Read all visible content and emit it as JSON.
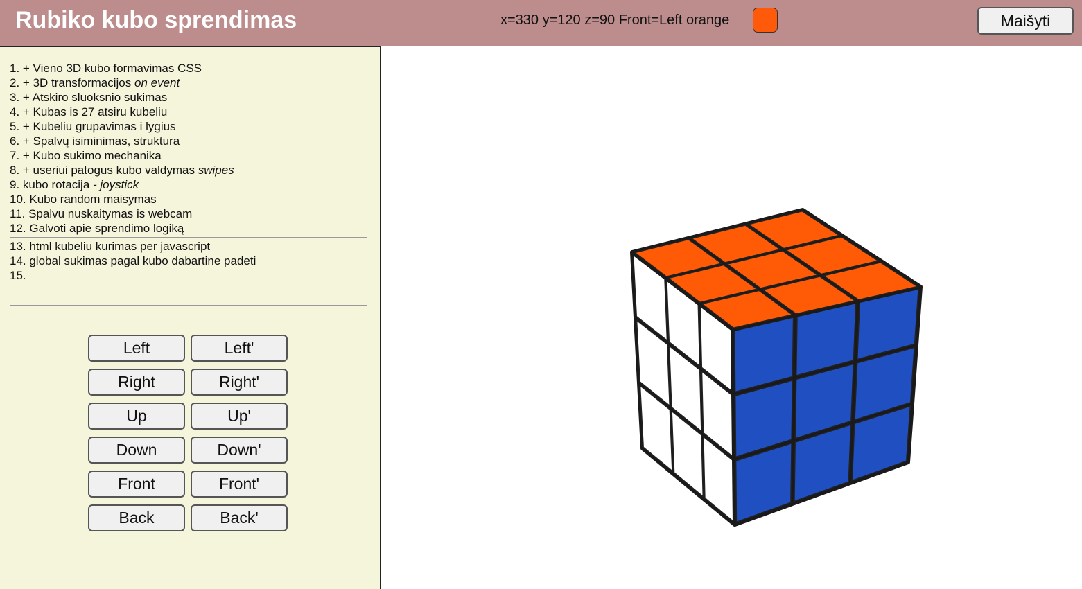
{
  "header": {
    "title": "Rubiko kubo sprendimas",
    "status": "x=330 y=120 z=90 Front=Left orange",
    "front_color": "#ff5a0a",
    "scramble_label": "Maišyti"
  },
  "tasks": [
    {
      "text": "1. + Vieno 3D kubo formavimas CSS",
      "em": ""
    },
    {
      "text": "2. + 3D transformacijos ",
      "em": "on event"
    },
    {
      "text": "3. + Atskiro sluoksnio sukimas",
      "em": ""
    },
    {
      "text": "4. + Kubas is 27 atsiru kubeliu",
      "em": ""
    },
    {
      "text": "5. + Kubeliu grupavimas i lygius",
      "em": ""
    },
    {
      "text": "6. + Spalvų isiminimas, struktura",
      "em": ""
    },
    {
      "text": "7. + Kubo sukimo mechanika",
      "em": ""
    },
    {
      "text": "8. + useriui patogus kubo valdymas ",
      "em": "swipes"
    },
    {
      "text": "9. kubo rotacija ",
      "em": "- joystick"
    },
    {
      "text": "10. Kubo random maisymas",
      "em": ""
    },
    {
      "text": "11. Spalvu nuskaitymas is webcam",
      "em": ""
    },
    {
      "text": "12. Galvoti apie sprendimo logiką",
      "em": ""
    },
    {
      "text": "13. html kubeliu kurimas per javascript",
      "em": ""
    },
    {
      "text": "14. global sukimas pagal kubo dabartine padeti",
      "em": ""
    },
    {
      "text": "15.",
      "em": ""
    }
  ],
  "controls": [
    {
      "label": "Left",
      "name": "left-button"
    },
    {
      "label": "Left'",
      "name": "left-prime-button"
    },
    {
      "label": "Right",
      "name": "right-button"
    },
    {
      "label": "Right'",
      "name": "right-prime-button"
    },
    {
      "label": "Up",
      "name": "up-button"
    },
    {
      "label": "Up'",
      "name": "up-prime-button"
    },
    {
      "label": "Down",
      "name": "down-button"
    },
    {
      "label": "Down'",
      "name": "down-prime-button"
    },
    {
      "label": "Front",
      "name": "front-button"
    },
    {
      "label": "Front'",
      "name": "front-prime-button"
    },
    {
      "label": "Back",
      "name": "back-button"
    },
    {
      "label": "Back'",
      "name": "back-prime-button"
    }
  ],
  "cube": {
    "colors": {
      "top": "#ff5a05",
      "front": "#1f4fc1",
      "side": "#ffffff",
      "body": "#1a1a1a"
    },
    "faces": {
      "top": [
        "orange",
        "orange",
        "orange",
        "orange",
        "orange",
        "orange",
        "orange",
        "orange",
        "orange"
      ],
      "front": [
        "blue",
        "blue",
        "blue",
        "blue",
        "blue",
        "blue",
        "blue",
        "blue",
        "blue"
      ],
      "left": [
        "white",
        "white",
        "white",
        "white",
        "white",
        "white",
        "white",
        "white",
        "white"
      ]
    }
  }
}
